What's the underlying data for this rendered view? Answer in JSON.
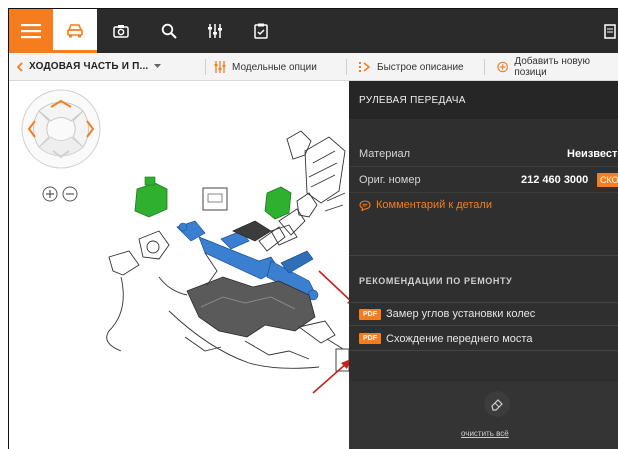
{
  "toolbar": {
    "icons": [
      "menu-icon",
      "car-icon",
      "camera-icon",
      "search-icon",
      "sliders-icon",
      "clipboard-icon",
      "document-icon"
    ],
    "accent": "#f47d20",
    "bar_color": "#2b2b2b"
  },
  "breadcrumb": {
    "title": "ХОДОВАЯ ЧАСТЬ И П...",
    "model_options": "Модельные опции",
    "quick_description": "Быстрое описание",
    "add_position": "Добавить новую позици"
  },
  "panel": {
    "title": "РУЛЕВАЯ ПЕРЕДАЧА",
    "material_label": "Материал",
    "material_value": "Неизвесте",
    "orig_label": "Ориг. номер",
    "orig_value": "212 460 3000",
    "orig_badge": "СКО",
    "comment": "Комментарий к детали",
    "recommendations_title": "РЕКОМЕНДАЦИИ ПО РЕМОНТУ",
    "recommendations": [
      {
        "badge": "PDF",
        "label": "Замер углов установки колес"
      },
      {
        "badge": "PDF",
        "label": "Схождение переднего моста"
      }
    ],
    "clear_all": "очистить всё",
    "bg_color": "#2f2f2f"
  }
}
